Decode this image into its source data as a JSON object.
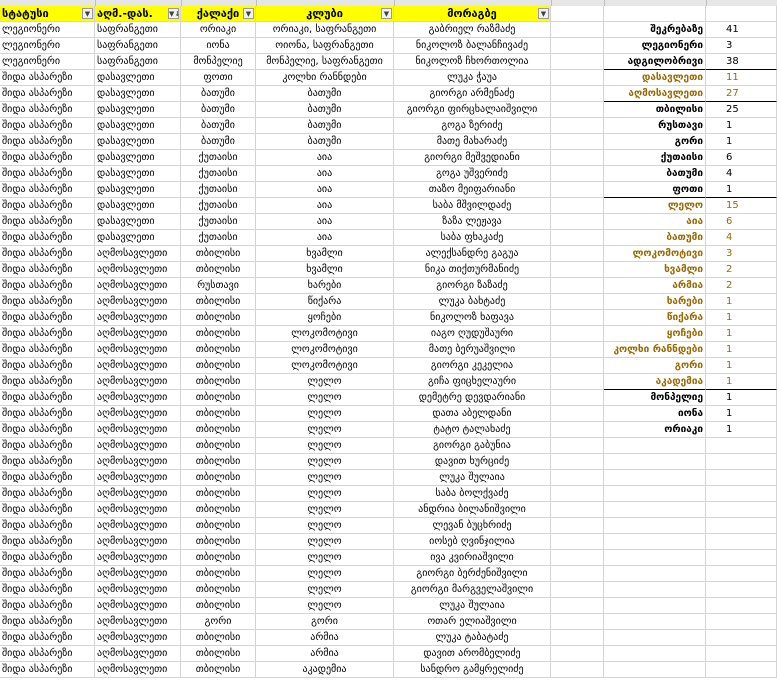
{
  "headers": [
    "სტატუსი",
    "აღმ.-დას.",
    "ქალაქი",
    "კლუბი",
    "მორაგბე"
  ],
  "rows": [
    [
      "ლეგიონერი",
      "საფრანგეთი",
      "ორიაკი",
      "ორიაკი, საფრანგეთი",
      "გაბრიელ რაზმაძე"
    ],
    [
      "ლეგიონერი",
      "საფრანგეთი",
      "იონა",
      "ოიონა, საფრანგეთი",
      "ნიკოლოზ ბალანჩივაძე"
    ],
    [
      "ლეგიონერი",
      "საფრანგეთი",
      "მონპელიე",
      "მონპელიე, საფრანგეთი",
      "ნიკოლოზ ჩხორთოლია"
    ],
    [
      "შიდა ასპარეზი",
      "დასავლეთი",
      "ფოთი",
      "კოლხი რანნდები",
      "ლუკა ჭაუა"
    ],
    [
      "შიდა ასპარეზი",
      "დასავლეთი",
      "ბათუმი",
      "ბათუმი",
      "გიორგი არმენაძე"
    ],
    [
      "შიდა ასპარეზი",
      "დასავლეთი",
      "ბათუმი",
      "ბათუმი",
      "გიორგი ფირცხალაიშვილი"
    ],
    [
      "შიდა ასპარეზი",
      "დასავლეთი",
      "ბათუმი",
      "ბათუმი",
      "გოგა ზერიძე"
    ],
    [
      "შიდა ასპარეზი",
      "დასავლეთი",
      "ბათუმი",
      "ბათუმი",
      "მათე მახარაძე"
    ],
    [
      "შიდა ასპარეზი",
      "დასავლეთი",
      "ქუთაისი",
      "აია",
      "გიორგი მეშვედიანი"
    ],
    [
      "შიდა ასპარეზი",
      "დასავლეთი",
      "ქუთაისი",
      "აია",
      "გოგა უშვერიძე"
    ],
    [
      "შიდა ასპარეზი",
      "დასავლეთი",
      "ქუთაისი",
      "აია",
      "თაზო მეიფარიანი"
    ],
    [
      "შიდა ასპარეზი",
      "დასავლეთი",
      "ქუთაისი",
      "აია",
      "საბა მშვილდაძე"
    ],
    [
      "შიდა ასპარეზი",
      "დასავლეთი",
      "ქუთაისი",
      "აია",
      "ზაზა ლეჟავა"
    ],
    [
      "შიდა ასპარეზი",
      "დასავლეთი",
      "ქუთაისი",
      "აია",
      "საბა ფხაკაძე"
    ],
    [
      "შიდა ასპარეზი",
      "აღმოსავლეთი",
      "თბილისი",
      "ხვამლი",
      "ალექსანდრე გაგუა"
    ],
    [
      "შიდა ასპარეზი",
      "აღმოსავლეთი",
      "თბილისი",
      "ხვამლი",
      "ნიკა თიქთურმანიძე"
    ],
    [
      "შიდა ასპარეზი",
      "აღმოსავლეთი",
      "რუსთავი",
      "ხარები",
      "გიორგი ზაზაძე"
    ],
    [
      "შიდა ასპარეზი",
      "აღმოსავლეთი",
      "თბილისი",
      "წიქარა",
      "ლუკა ბახტაძე"
    ],
    [
      "შიდა ასპარეზი",
      "აღმოსავლეთი",
      "თბილისი",
      "ყოჩები",
      "ნიკოლოზ ხაფავა"
    ],
    [
      "შიდა ასპარეზი",
      "აღმოსავლეთი",
      "თბილისი",
      "ლოკომოტივი",
      "იაგო ღუდუშაური"
    ],
    [
      "შიდა ასპარეზი",
      "აღმოსავლეთი",
      "თბილისი",
      "ლოკომოტივი",
      "მათე ბერუაშვილი"
    ],
    [
      "შიდა ასპარეზი",
      "აღმოსავლეთი",
      "თბილისი",
      "ლოკომოტივი",
      "გიორგი კეკელია"
    ],
    [
      "შიდა ასპარეზი",
      "აღმოსავლეთი",
      "თბილისი",
      "ლელო",
      "გიჩა ფიცხელაური"
    ],
    [
      "შიდა ასპარეზი",
      "აღმოსავლეთი",
      "თბილისი",
      "ლელო",
      "დემეტრე დევდარიანი"
    ],
    [
      "შიდა ასპარეზი",
      "აღმოსავლეთი",
      "თბილისი",
      "ლელო",
      "დათა აბელდანი"
    ],
    [
      "შიდა ასპარეზი",
      "აღმოსავლეთი",
      "თბილისი",
      "ლელო",
      "ტატო ტალახაძე"
    ],
    [
      "შიდა ასპარეზი",
      "აღმოსავლეთი",
      "თბილისი",
      "ლელო",
      "გიორგი გაბუნია"
    ],
    [
      "შიდა ასპარეზი",
      "აღმოსავლეთი",
      "თბილისი",
      "ლელო",
      "დავით ხურციძე"
    ],
    [
      "შიდა ასპარეზი",
      "აღმოსავლეთი",
      "თბილისი",
      "ლელო",
      "ლუკა შულაია"
    ],
    [
      "შიდა ასპარეზი",
      "აღმოსავლეთი",
      "თბილისი",
      "ლელო",
      "საბა ბოლქვაძე"
    ],
    [
      "შიდა ასპარეზი",
      "აღმოსავლეთი",
      "თბილისი",
      "ლელო",
      "ანდრია ბილანიშვილი"
    ],
    [
      "შიდა ასპარეზი",
      "აღმოსავლეთი",
      "თბილისი",
      "ლელო",
      "ლევან ბუცხრიძე"
    ],
    [
      "შიდა ასპარეზი",
      "აღმოსავლეთი",
      "თბილისი",
      "ლელო",
      "იოსებ ღვინჯილია"
    ],
    [
      "შიდა ასპარეზი",
      "აღმოსავლეთი",
      "თბილისი",
      "ლელო",
      "ივა კვირიაშვილი"
    ],
    [
      "შიდა ასპარეზი",
      "აღმოსავლეთი",
      "თბილისი",
      "ლელო",
      "გიორგი ბერძენიშვილი"
    ],
    [
      "შიდა ასპარეზი",
      "აღმოსავლეთი",
      "თბილისი",
      "ლელო",
      "გიორგი მარგველაშვილი"
    ],
    [
      "შიდა ასპარეზი",
      "აღმოსავლეთი",
      "თბილისი",
      "ლელო",
      "ლუკა შულაია"
    ],
    [
      "შიდა ასპარეზი",
      "აღმოსავლეთი",
      "გორი",
      "გორი",
      "ოთარ ელიაშვილი"
    ],
    [
      "შიდა ასპარეზი",
      "აღმოსავლეთი",
      "თბილისი",
      "არმია",
      "ლუკა ტაბატაძე"
    ],
    [
      "შიდა ასპარეზი",
      "აღმოსავლეთი",
      "თბილისი",
      "არმია",
      "დავით არომბელიძე"
    ],
    [
      "შიდა ასპარეზი",
      "აღმოსავლეთი",
      "თბილისი",
      "აკადემია",
      "სანდრო გამყრელიძე"
    ]
  ],
  "summary": [
    {
      "label": "შეკრებაზე",
      "value": "41",
      "style": "plain"
    },
    {
      "label": "ლეგიონერი",
      "value": "3",
      "style": "plain"
    },
    {
      "label": "ადგილობრივი",
      "value": "38",
      "style": "ul"
    },
    {
      "label": "დასავლეთი",
      "value": "11",
      "style": "gold"
    },
    {
      "label": "აღმოსავლეთი",
      "value": "27",
      "style": "gold-ul"
    },
    {
      "label": "თბილისი",
      "value": "25",
      "style": "plain"
    },
    {
      "label": "რუსთავი",
      "value": "1",
      "style": "plain"
    },
    {
      "label": "გორი",
      "value": "1",
      "style": "plain"
    },
    {
      "label": "ქუთაისი",
      "value": "6",
      "style": "plain"
    },
    {
      "label": "ბათუმი",
      "value": "4",
      "style": "plain"
    },
    {
      "label": "ფოთი",
      "value": "1",
      "style": "ul"
    },
    {
      "label": "ლელო",
      "value": "15",
      "style": "gold"
    },
    {
      "label": "აია",
      "value": "6",
      "style": "gold"
    },
    {
      "label": "ბათუმი",
      "value": "4",
      "style": "gold"
    },
    {
      "label": "ლოკომოტივი",
      "value": "3",
      "style": "gold"
    },
    {
      "label": "ხვამლი",
      "value": "2",
      "style": "gold"
    },
    {
      "label": "არმია",
      "value": "2",
      "style": "gold"
    },
    {
      "label": "ხარები",
      "value": "1",
      "style": "gold"
    },
    {
      "label": "წიქარა",
      "value": "1",
      "style": "gold"
    },
    {
      "label": "ყოჩები",
      "value": "1",
      "style": "gold"
    },
    {
      "label": "კოლხი რანნდები",
      "value": "1",
      "style": "gold"
    },
    {
      "label": "გორი",
      "value": "1",
      "style": "gold"
    },
    {
      "label": "აკადემია",
      "value": "1",
      "style": "gold-ul"
    },
    {
      "label": "მონპელიე",
      "value": "1",
      "style": "plain"
    },
    {
      "label": "იონა",
      "value": "1",
      "style": "plain"
    },
    {
      "label": "ორიაკი",
      "value": "1",
      "style": "plain"
    }
  ],
  "icons": {
    "filter": "filter-dropdown-icon",
    "sorted_filter": "sort-filter-icon"
  }
}
